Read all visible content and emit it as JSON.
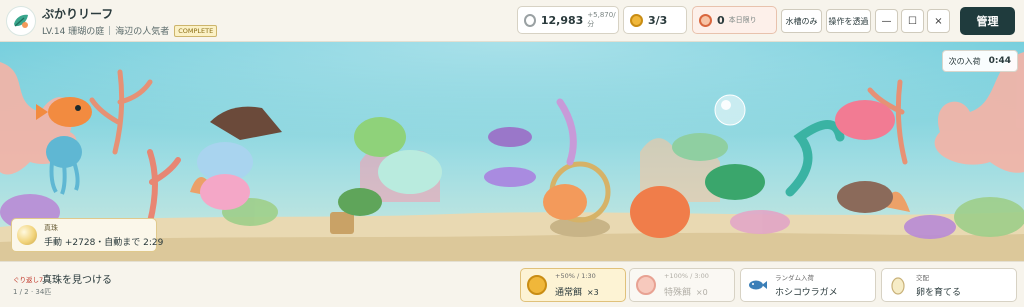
{
  "header": {
    "title": "ぷかりリーフ",
    "level": "LV.14 珊瑚の庭",
    "rank": "海辺の人気者",
    "badge": "COMPLETE"
  },
  "stats": {
    "coins": "12,983",
    "coins_rate": "+5,870/分",
    "feed": "3/3",
    "limited": "0",
    "limited_label": "本日限り"
  },
  "toolbar": {
    "aquarium_only": "水槽のみ",
    "transparent": "操作を透過",
    "minimize": "—",
    "maximize": "☐",
    "close": "×",
    "manage": "管理"
  },
  "scene": {
    "next_arrival_label": "次の入荷",
    "next_arrival_time": "0:44",
    "pearl_label": "真珠",
    "pearl_status": "手動 +2728・自動まで 2:29"
  },
  "quest": {
    "tag": "ぐり返し7",
    "title": "真珠を見つける",
    "progress": "1 / 2 · 34匹"
  },
  "actions": [
    {
      "top": "+50% / 1:30",
      "label": "通常餌",
      "count": "×3"
    },
    {
      "top": "+100% / 3:00",
      "label": "特殊餌",
      "count": "×0"
    },
    {
      "top": "ランダム入荷",
      "label": "ホシコウラガメ"
    },
    {
      "top": "交配",
      "label": "卵を育てる"
    }
  ],
  "colors": {
    "accent_dark": "#1f3b3d",
    "water_top": "#5fc4d6",
    "sand": "#e9d9b2",
    "coral_pink": "#f2a0b3",
    "coral_orange": "#f39a5b",
    "pearl_gold": "#f2d47c"
  },
  "icons": [
    "logo-leaf-icon",
    "coin-icon",
    "feed-icon",
    "limited-icon",
    "pearl-icon",
    "fish-icon",
    "egg-icon"
  ]
}
